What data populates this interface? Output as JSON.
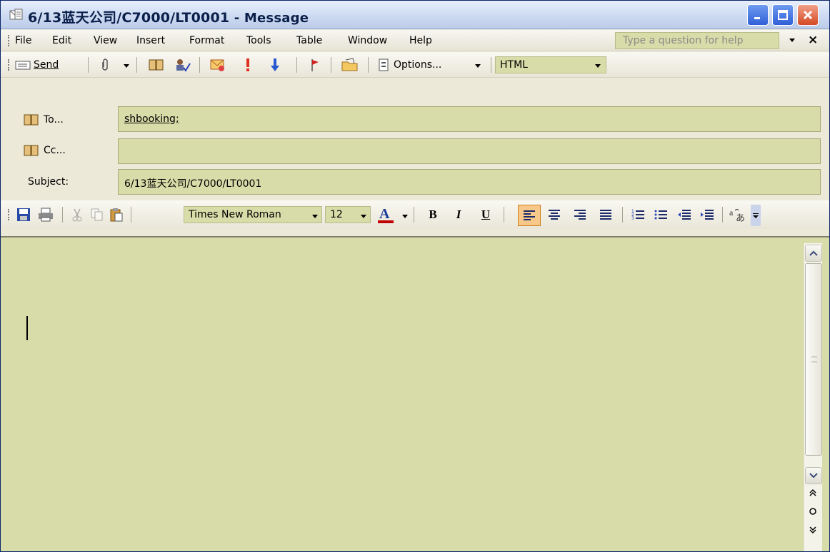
{
  "window": {
    "title_subject": "6/13蓝天公司/C7000/LT0001",
    "title_suffix": " - Message"
  },
  "menu": {
    "items": [
      "File",
      "Edit",
      "View",
      "Insert",
      "Format",
      "Tools",
      "Table",
      "Window",
      "Help"
    ],
    "help_placeholder": "Type a question for help"
  },
  "toolbar": {
    "send_label": "Send",
    "options_label": "Options...",
    "format_value": "HTML"
  },
  "fields": {
    "to_label": "To...",
    "to_value": "shbooking;",
    "cc_label": "Cc...",
    "cc_value": "",
    "subject_label": "Subject:",
    "subject_value": "6/13蓝天公司/C7000/LT0001"
  },
  "format_toolbar": {
    "font_name": "Times New Roman",
    "font_size": "12",
    "bold": "B",
    "italic": "I",
    "underline": "U",
    "accent_color": "#c00000"
  },
  "body": {
    "text": ""
  }
}
